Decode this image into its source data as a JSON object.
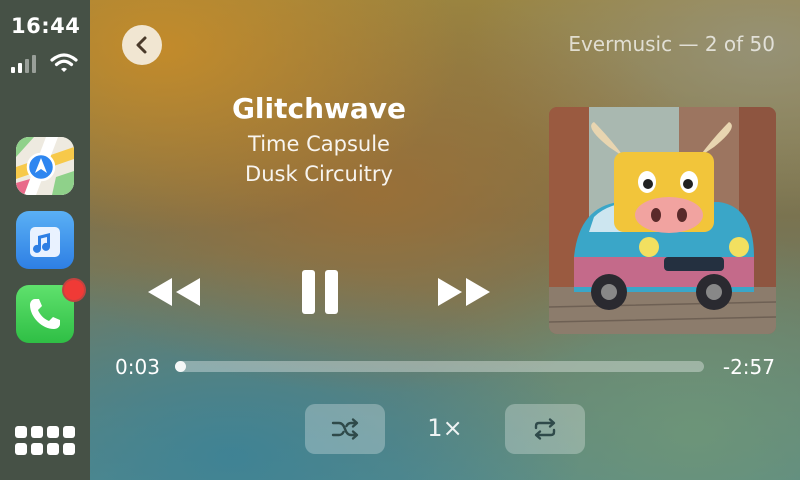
{
  "status": {
    "time": "16:44"
  },
  "sidebar": {
    "apps": [
      {
        "name": "Maps",
        "icon": "maps-icon"
      },
      {
        "name": "Music",
        "icon": "music-icon"
      },
      {
        "name": "Phone",
        "icon": "phone-icon",
        "badge": true
      }
    ],
    "home_icon": "app-grid-icon"
  },
  "header": {
    "source": "Evermusic — 2 of 50"
  },
  "track": {
    "title": "Glitchwave",
    "album": "Time Capsule",
    "artist": "Dusk Circuitry",
    "artwork": "album-art-bull-on-car"
  },
  "playback": {
    "elapsed": "0:03",
    "remaining": "-2:57",
    "progress_fraction": 0.02,
    "speed": "1×",
    "state": "playing"
  },
  "colors": {
    "badge": "#f03a36",
    "back_button": "#f1e6d2"
  }
}
